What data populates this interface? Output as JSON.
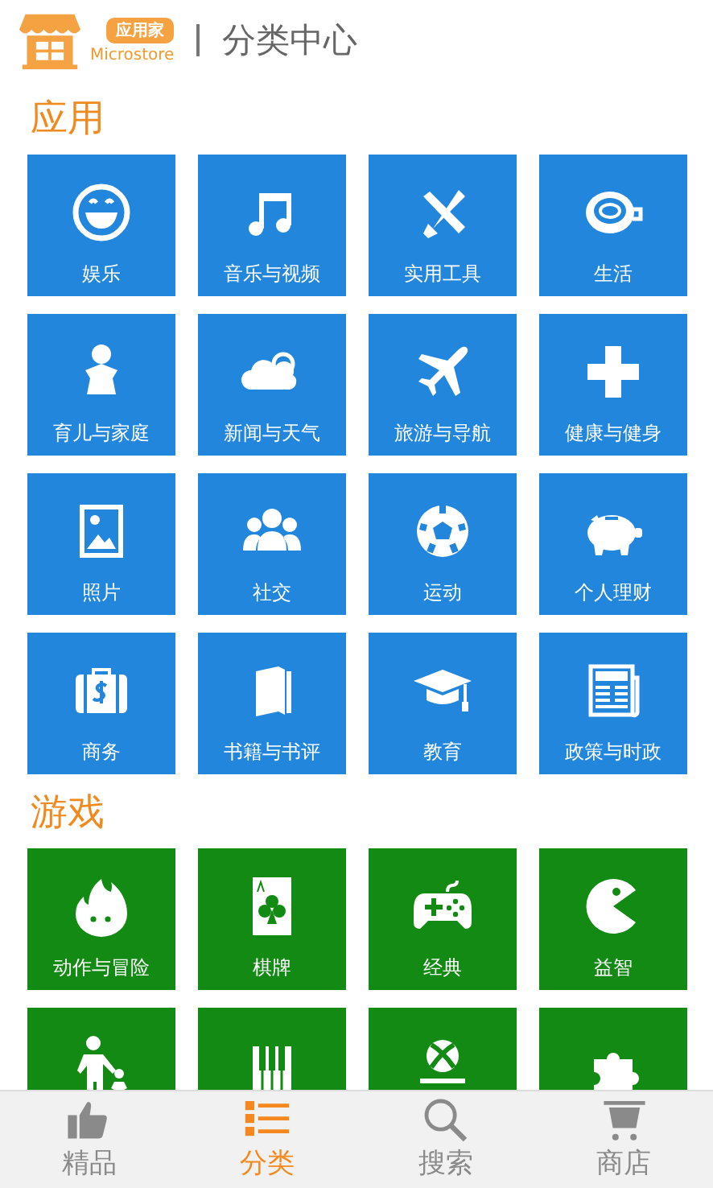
{
  "header": {
    "logo_badge": "应用家",
    "logo_text": "Microstore",
    "title": "分类中心"
  },
  "sections": [
    {
      "title": "应用",
      "kind": "app",
      "tiles": [
        {
          "kind": "labeled",
          "label": "娱乐"
        },
        {
          "kind": "labeled",
          "label": "音乐与视频"
        },
        {
          "kind": "labeled",
          "label": "实用工具"
        },
        {
          "kind": "labeled",
          "label": "生活"
        },
        {
          "kind": "labeled",
          "label": "育儿与家庭"
        },
        {
          "kind": "labeled",
          "label": "新闻与天气"
        },
        {
          "kind": "labeled",
          "label": "旅游与导航"
        },
        {
          "kind": "labeled",
          "label": "健康与健身"
        },
        {
          "kind": "labeled",
          "label": "照片"
        },
        {
          "kind": "labeled",
          "label": "社交"
        },
        {
          "kind": "labeled",
          "label": "运动"
        },
        {
          "kind": "labeled",
          "label": "个人理财"
        },
        {
          "kind": "labeled",
          "label": "商务"
        },
        {
          "kind": "labeled",
          "label": "书籍与书评"
        },
        {
          "kind": "labeled",
          "label": "教育"
        },
        {
          "kind": "labeled",
          "label": "政策与时政"
        }
      ]
    },
    {
      "title": "游戏",
      "kind": "game",
      "tiles": [
        {
          "kind": "labeled",
          "label": "动作与冒险"
        },
        {
          "kind": "labeled",
          "label": "棋牌"
        },
        {
          "kind": "labeled",
          "label": "经典"
        },
        {
          "kind": "labeled",
          "label": "益智"
        },
        {
          "kind": "cut"
        },
        {
          "kind": "cut"
        },
        {
          "kind": "cut"
        },
        {
          "kind": "cut"
        }
      ]
    }
  ],
  "nav": [
    {
      "label": "精品",
      "selected": false
    },
    {
      "label": "分类",
      "selected": true
    },
    {
      "label": "搜索",
      "selected": false
    },
    {
      "label": "商店",
      "selected": false
    }
  ]
}
